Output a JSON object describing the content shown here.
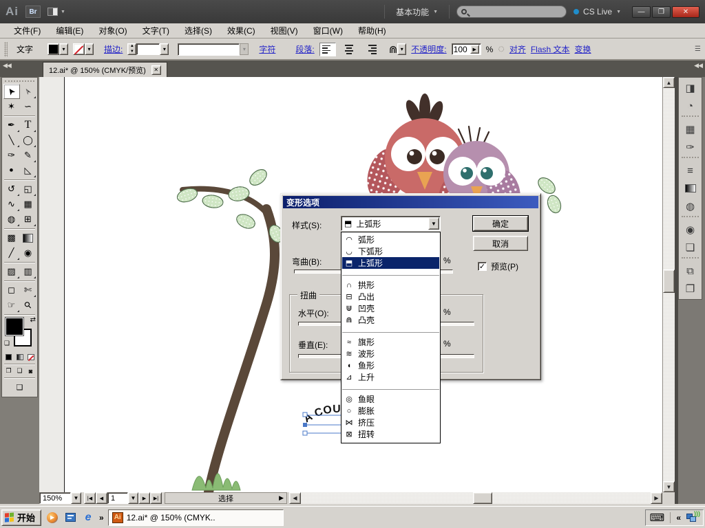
{
  "titlebar": {
    "logo": "Ai",
    "bridge_label": "Br",
    "workspace_label": "基本功能",
    "cslive_label": "CS Live",
    "dropdown_glyph": "▼",
    "minimize_glyph": "—",
    "restore_glyph": "❐",
    "close_glyph": "✕"
  },
  "menubar": {
    "items": [
      {
        "label": "文件(F)"
      },
      {
        "label": "编辑(E)"
      },
      {
        "label": "对象(O)"
      },
      {
        "label": "文字(T)"
      },
      {
        "label": "选择(S)"
      },
      {
        "label": "效果(C)"
      },
      {
        "label": "视图(V)"
      },
      {
        "label": "窗口(W)"
      },
      {
        "label": "帮助(H)"
      }
    ]
  },
  "controlbar": {
    "context_label": "文字",
    "stroke_link": "描边:",
    "character_link": "字符",
    "paragraph_link": "段落:",
    "warp_icon": "⋒",
    "opacity_link": "不透明度:",
    "opacity_value": "100",
    "opacity_spin": "▶",
    "percent": "%",
    "style_dial_icon": "◌",
    "align_link": "对齐",
    "flash_link": "Flash 文本",
    "transform_link": "变换",
    "panel_menu_icon": "☰"
  },
  "doc_tab": {
    "title": "12.ai* @ 150%  (CMYK/预览)",
    "close_glyph": "✕"
  },
  "dock_collapse_glyph": "◀◀",
  "tools": [
    {
      "name": "selection-tool",
      "glyph": "➤"
    },
    {
      "name": "direct-selection-tool",
      "glyph": "➢"
    },
    {
      "name": "magic-wand-tool",
      "glyph": "✶"
    },
    {
      "name": "lasso-tool",
      "glyph": "∽"
    },
    {
      "name": "pen-tool",
      "glyph": "✒"
    },
    {
      "name": "type-tool",
      "glyph": "T"
    },
    {
      "name": "line-segment-tool",
      "glyph": "╲"
    },
    {
      "name": "ellipse-tool",
      "glyph": "◯"
    },
    {
      "name": "paintbrush-tool",
      "glyph": "✑"
    },
    {
      "name": "pencil-tool",
      "glyph": "✎"
    },
    {
      "name": "blob-brush-tool",
      "glyph": "⚫"
    },
    {
      "name": "eraser-tool",
      "glyph": "◺"
    },
    {
      "name": "rotate-tool",
      "glyph": "↺"
    },
    {
      "name": "scale-tool",
      "glyph": "◱"
    },
    {
      "name": "width-tool",
      "glyph": "∿"
    },
    {
      "name": "free-transform-tool",
      "glyph": "▦"
    },
    {
      "name": "shape-builder-tool",
      "glyph": "◍"
    },
    {
      "name": "perspective-grid-tool",
      "glyph": "⊞"
    },
    {
      "name": "mesh-tool",
      "glyph": "▩"
    },
    {
      "name": "gradient-tool",
      "glyph": ""
    },
    {
      "name": "eyedropper-tool",
      "glyph": "╱"
    },
    {
      "name": "blend-tool",
      "glyph": "◉"
    },
    {
      "name": "symbol-sprayer-tool",
      "glyph": "▨"
    },
    {
      "name": "column-graph-tool",
      "glyph": "▥"
    },
    {
      "name": "artboard-tool",
      "glyph": "◻"
    },
    {
      "name": "slice-tool",
      "glyph": "✄"
    },
    {
      "name": "hand-tool",
      "glyph": "☞"
    },
    {
      "name": "zoom-tool",
      "glyph": "⚲"
    }
  ],
  "right_dock": [
    {
      "name": "color-panel",
      "glyph": "◨"
    },
    {
      "name": "color-guide-panel",
      "glyph": "◔"
    },
    {
      "name": "swatches-panel",
      "glyph": "▦"
    },
    {
      "name": "brushes-panel",
      "glyph": "✑"
    },
    {
      "name": "stroke-panel",
      "glyph": "≡"
    },
    {
      "name": "gradient-panel",
      "glyph": ""
    },
    {
      "name": "transparency-panel",
      "glyph": "◍"
    },
    {
      "name": "appearance-panel",
      "glyph": "◉"
    },
    {
      "name": "graphic-styles-panel",
      "glyph": "❏"
    },
    {
      "name": "layers-panel",
      "glyph": "⧉"
    },
    {
      "name": "artboards-panel",
      "glyph": "❐"
    }
  ],
  "dialog": {
    "title": "变形选项",
    "style_label": "样式(S):",
    "style_value": "上弧形",
    "style_icon": "⬒",
    "combo_arrow": "▼",
    "bend_label": "弯曲(B):",
    "distort_label": "扭曲",
    "horizontal_label": "水平(O):",
    "vertical_label": "垂直(E):",
    "percent": "%",
    "ok_label": "确定",
    "cancel_label": "取消",
    "preview_label": "预览(P)",
    "check_glyph": "✓",
    "list": [
      {
        "icon": "◠",
        "label": "弧形"
      },
      {
        "icon": "◡",
        "label": "下弧形"
      },
      {
        "icon": "⬒",
        "label": "上弧形",
        "selected": true
      },
      {
        "icon": "∩",
        "label": "拱形"
      },
      {
        "icon": "⊟",
        "label": "凸出"
      },
      {
        "icon": "⋓",
        "label": "凹壳"
      },
      {
        "icon": "⋒",
        "label": "凸壳"
      },
      {
        "icon": "≈",
        "label": "旗形"
      },
      {
        "icon": "≋",
        "label": "波形"
      },
      {
        "icon": "◖",
        "label": "鱼形"
      },
      {
        "icon": "⊿",
        "label": "上升"
      },
      {
        "icon": "◎",
        "label": "鱼眼"
      },
      {
        "icon": "○",
        "label": "膨胀"
      },
      {
        "icon": "⋈",
        "label": "挤压"
      },
      {
        "icon": "⊠",
        "label": "扭转"
      }
    ]
  },
  "statusbar": {
    "zoom_value": "150%",
    "first_glyph": "|◀",
    "prev_glyph": "◀",
    "page_value": "1",
    "next_glyph": "▶",
    "last_glyph": "▶|",
    "status_text": "选择",
    "status_arrow": "▶",
    "scroll_left": "◀",
    "scroll_right": "▶",
    "scroll_up": "▲",
    "scroll_down": "▼"
  },
  "artwork": {
    "warp_text": "A COU"
  },
  "taskbar": {
    "start_label": "开始",
    "chevron": "»",
    "app_button_label": "12.ai* @ 150%  (CMYK..",
    "ai_badge": "Ai",
    "ie_glyph": "e",
    "media_glyph": "▶",
    "keyboard_icon": "⌨",
    "tray_chevron": "«"
  }
}
